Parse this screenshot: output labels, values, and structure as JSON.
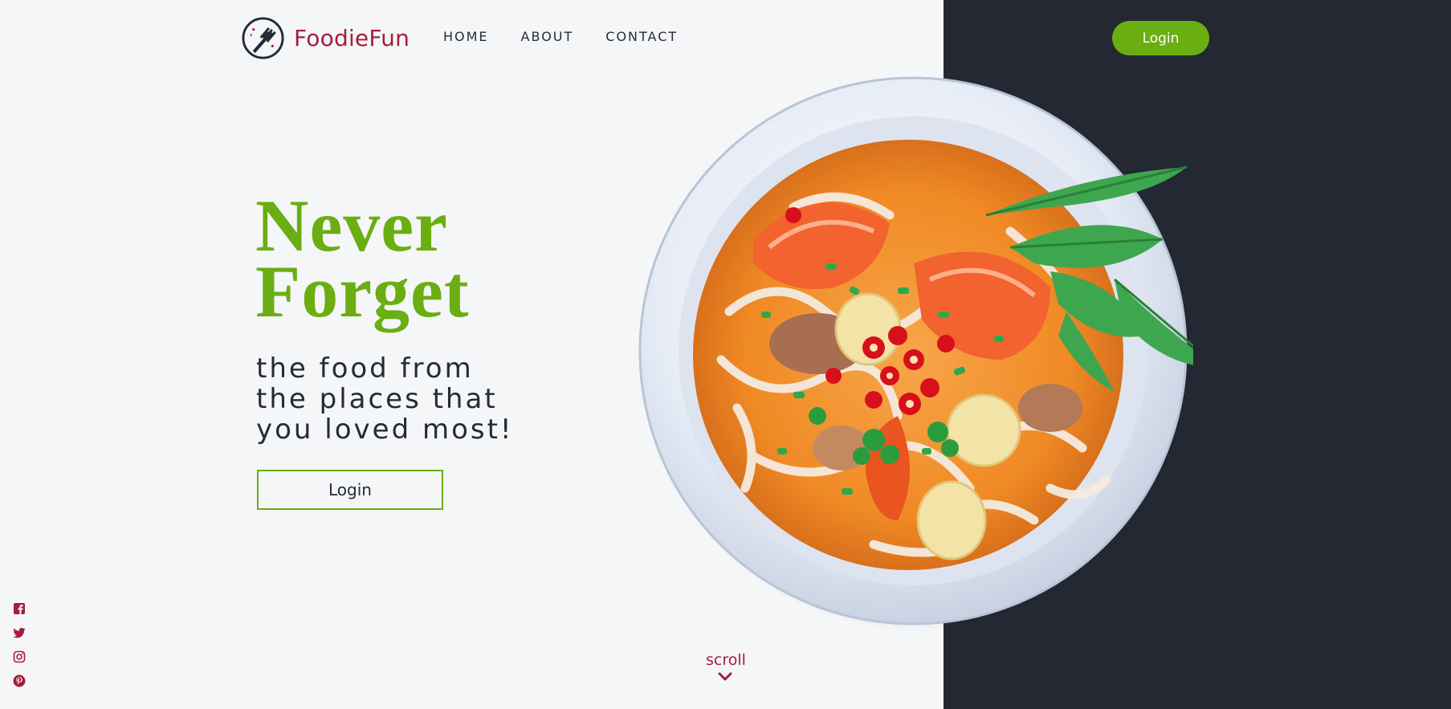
{
  "brand": {
    "name": "FoodieFun",
    "logo_icon": "fork-logo-icon",
    "color": "#a51d3c"
  },
  "nav": {
    "items": [
      {
        "label": "HOME"
      },
      {
        "label": "ABOUT"
      },
      {
        "label": "CONTACT"
      }
    ]
  },
  "header": {
    "login_label": "Login"
  },
  "hero": {
    "headline_line1": "Never",
    "headline_line2": "Forget",
    "tagline_line1": "the food from",
    "tagline_line2": "the places that",
    "tagline_line3": "you loved most!",
    "login_label": "Login",
    "image_subject": "bowl of noodle soup with shrimp, quail eggs, chilies and herbs"
  },
  "social": {
    "icons": [
      "facebook-icon",
      "twitter-icon",
      "instagram-icon",
      "pinterest-icon"
    ]
  },
  "scroll": {
    "label": "scroll",
    "icon": "chevron-down-icon"
  },
  "colors": {
    "accent_green": "#6aae12",
    "brand_crimson": "#a51d3c",
    "dark_panel": "#232833",
    "background": "#f5f6f8"
  }
}
